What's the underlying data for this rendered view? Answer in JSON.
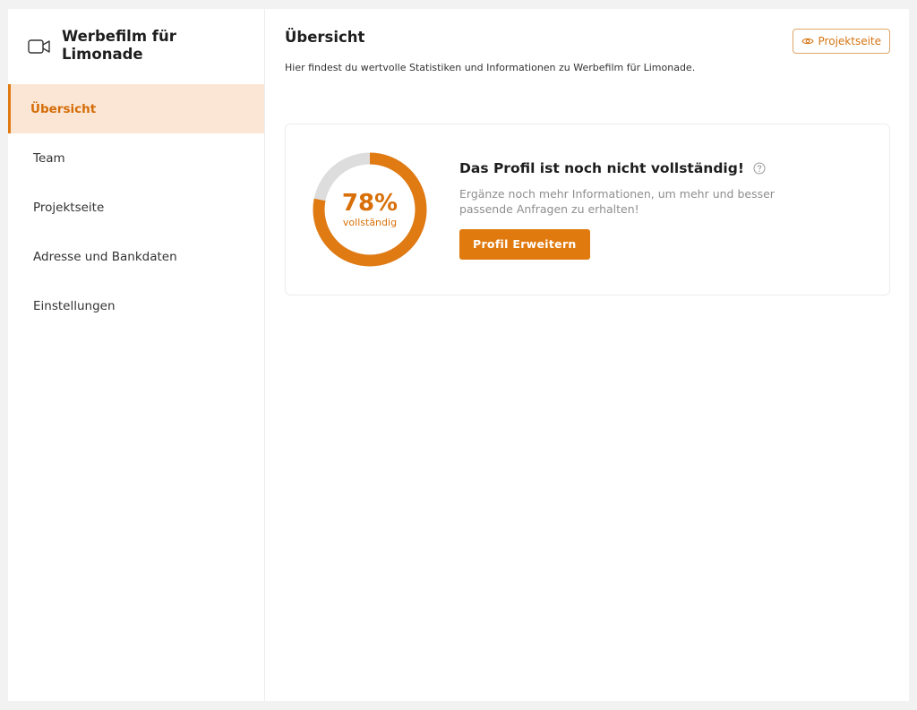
{
  "sidebar": {
    "project_title": "Werbefilm für Limonade",
    "project_icon": "video-camera-icon",
    "items": [
      {
        "label": "Übersicht",
        "active": true
      },
      {
        "label": "Team",
        "active": false
      },
      {
        "label": "Projektseite",
        "active": false
      },
      {
        "label": "Adresse und Bankdaten",
        "active": false
      },
      {
        "label": "Einstellungen",
        "active": false
      }
    ]
  },
  "header": {
    "title": "Übersicht",
    "description": "Hier findest du wertvolle Statistiken und Informationen zu Werbefilm für Limonade.",
    "project_button_label": "Projektseite",
    "project_button_icon": "eye-icon"
  },
  "profile_card": {
    "percent_value": 78,
    "percent_label": "78%",
    "percent_caption": "vollständig",
    "title": "Das Profil ist noch nicht vollständig!",
    "help_icon": "help-circle-icon",
    "description": "Ergänze noch mehr Informationen, um mehr und besser passende Anfragen zu erhalten!",
    "button_label": "Profil Erweitern"
  },
  "colors": {
    "accent": "#e07a12",
    "active_bg": "#fbe6d5",
    "ring_track": "#dddddd",
    "muted_text": "#8e8e8e"
  }
}
